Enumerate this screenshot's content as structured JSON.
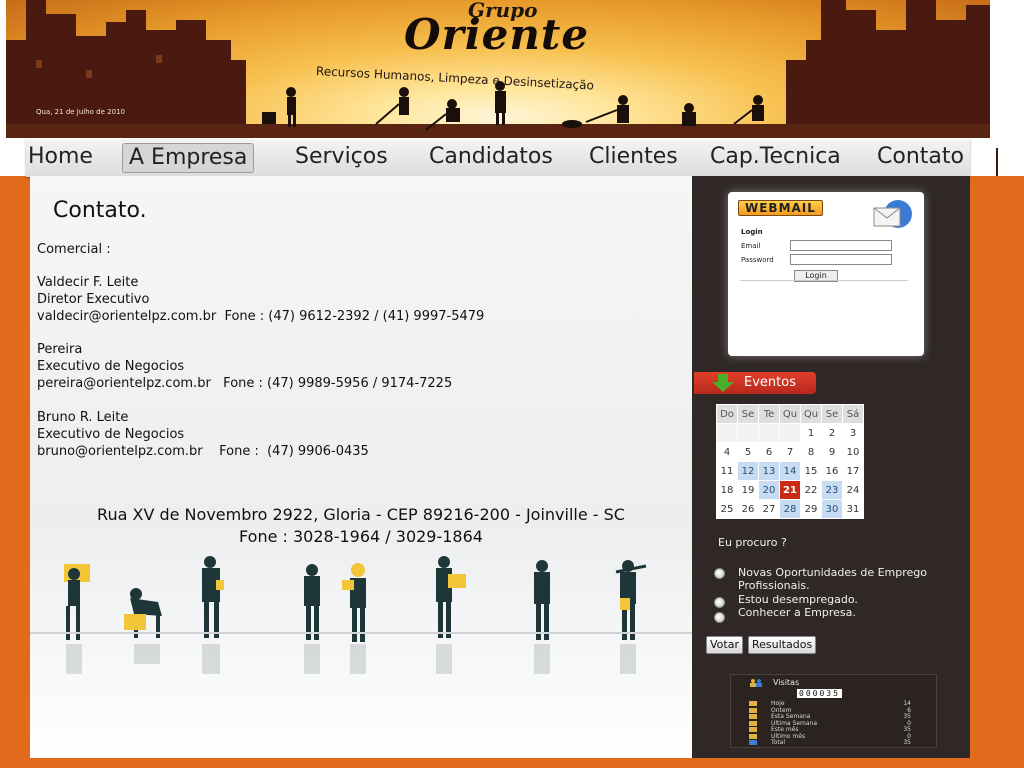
{
  "banner": {
    "logo_top": "Grupo",
    "logo_main": "Oriente",
    "tagline": "Recursos Humanos, Limpeza e Desinsetização",
    "date": "Qua, 21 de Julho de 2010"
  },
  "nav": {
    "items": [
      {
        "label": "Home"
      },
      {
        "label": "A Empresa"
      },
      {
        "label": "Serviços"
      },
      {
        "label": "Candidatos"
      },
      {
        "label": "Clientes"
      },
      {
        "label": "Cap.Tecnica"
      },
      {
        "label": "Contato"
      }
    ],
    "active": "A Empresa"
  },
  "main": {
    "title": "Contato.",
    "section_label": "Comercial :",
    "contacts": [
      {
        "name": "Valdecir F. Leite",
        "role": "Diretor Executivo",
        "line": "valdecir@orientelpz.com.br  Fone : (47) 9612-2392 / (41) 9997-5479"
      },
      {
        "name": "Pereira",
        "role": "Executivo de Negocios",
        "line": "pereira@orientelpz.com.br   Fone : (47) 9989-5956 / 9174-7225"
      },
      {
        "name": "Bruno R. Leite",
        "role": "Executivo de Negocios",
        "line": "bruno@orientelpz.com.br    Fone :  (47) 9906-0435"
      }
    ],
    "address_line1": "Rua XV de Novembro 2922, Gloria - CEP 89216-200 - Joinville - SC",
    "address_line2": "Fone : 3028-1964 / 3029-1864"
  },
  "webmail": {
    "title": "WEBMAIL",
    "login_label": "Login",
    "email_label": "Email",
    "password_label": "Password",
    "email_value": "",
    "password_value": "",
    "button_label": "Login"
  },
  "events": {
    "title": "Eventos",
    "weekdays": [
      "Do",
      "Se",
      "Te",
      "Qu",
      "Qu",
      "Se",
      "Sá"
    ],
    "weeks": [
      [
        "",
        "",
        "",
        "",
        "1",
        "2",
        "3"
      ],
      [
        "4",
        "5",
        "6",
        "7",
        "8",
        "9",
        "10"
      ],
      [
        "11",
        "12",
        "13",
        "14",
        "15",
        "16",
        "17"
      ],
      [
        "18",
        "19",
        "20",
        "21",
        "22",
        "23",
        "24"
      ],
      [
        "25",
        "26",
        "27",
        "28",
        "29",
        "30",
        "31"
      ]
    ],
    "event_days": [
      "12",
      "13",
      "14",
      "20",
      "23",
      "28",
      "30"
    ],
    "today": "21"
  },
  "poll": {
    "question": "Eu procuro ?",
    "options": [
      "Novas Oportunidades de Emprego",
      "Profissionais.",
      "Estou desempregado.",
      "Conhecer a Empresa."
    ],
    "vote_label": "Votar",
    "results_label": "Resultados"
  },
  "visits": {
    "title": "Visitas",
    "counter": "000035",
    "rows": [
      {
        "label": "Hoje",
        "value": "14"
      },
      {
        "label": "Ontem",
        "value": "6"
      },
      {
        "label": "Esta Semana",
        "value": "35"
      },
      {
        "label": "Ultima Semana",
        "value": "0"
      },
      {
        "label": "Este mês",
        "value": "35"
      },
      {
        "label": "Ultimo mês",
        "value": "0"
      },
      {
        "label": "Total",
        "value": "35"
      }
    ]
  },
  "colors": {
    "frame_orange": "#e26a1c",
    "sidebar_dark": "#2f2826",
    "today_red": "#c82a14",
    "event_blue": "#c7dcf2"
  }
}
